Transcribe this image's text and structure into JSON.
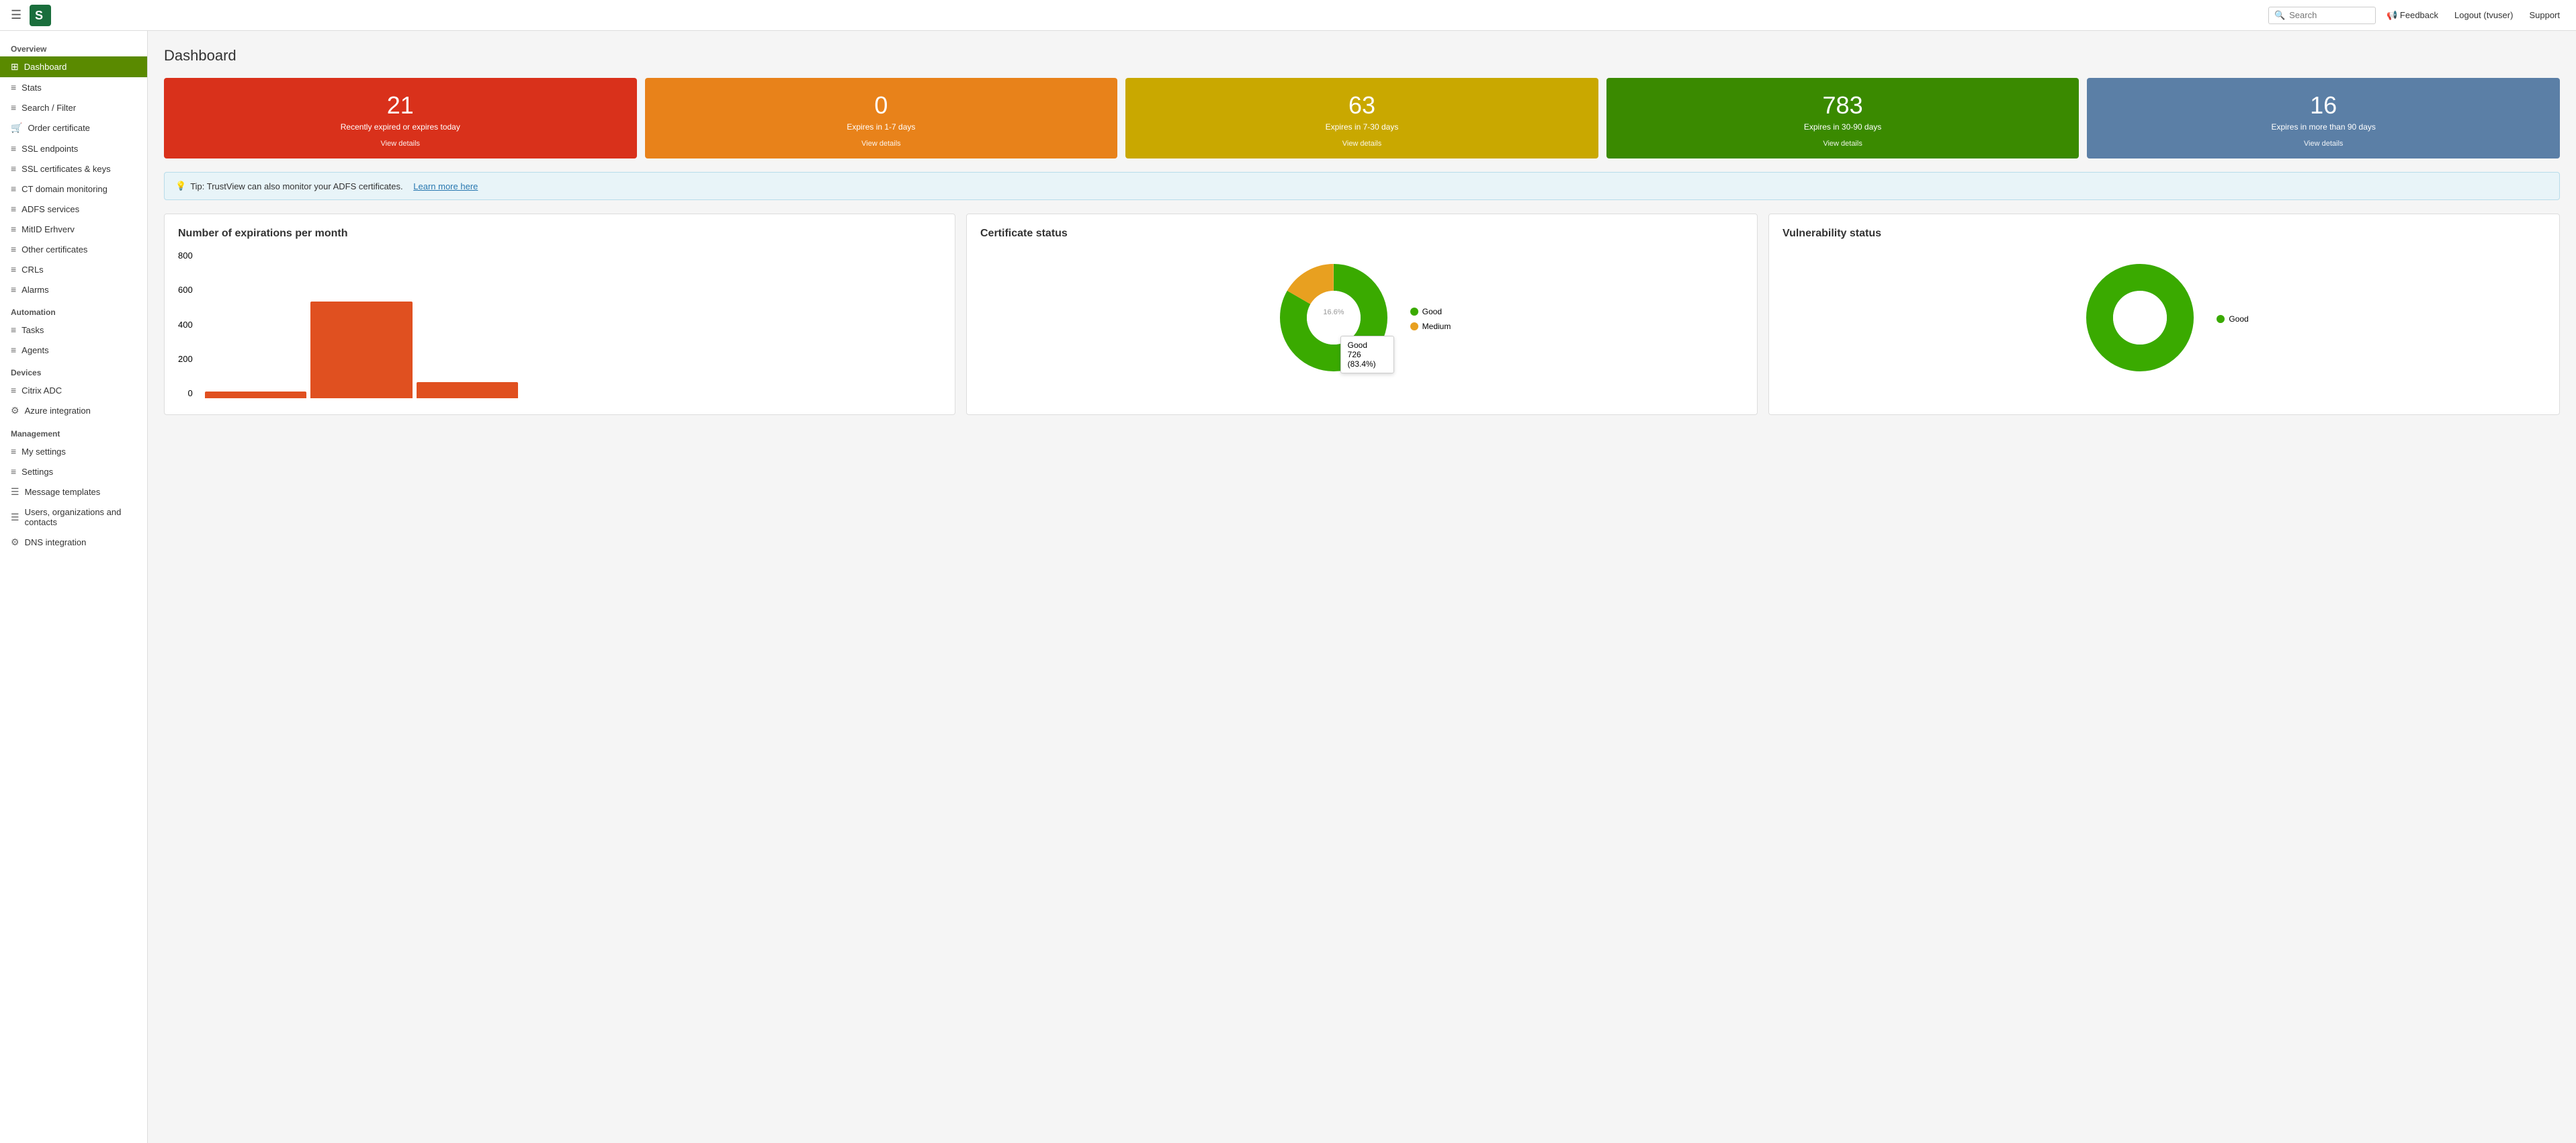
{
  "topbar": {
    "search_placeholder": "Search",
    "feedback_label": "Feedback",
    "logout_label": "Logout (tvuser)",
    "support_label": "Support"
  },
  "sidebar": {
    "overview_section": "Overview",
    "automation_section": "Automation",
    "devices_section": "Devices",
    "management_section": "Management",
    "items": [
      {
        "id": "dashboard",
        "label": "Dashboard",
        "active": true
      },
      {
        "id": "stats",
        "label": "Stats",
        "active": false
      },
      {
        "id": "search-filter",
        "label": "Search / Filter",
        "active": false
      },
      {
        "id": "order-certificate",
        "label": "Order certificate",
        "active": false
      },
      {
        "id": "ssl-endpoints",
        "label": "SSL endpoints",
        "active": false
      },
      {
        "id": "ssl-certificates",
        "label": "SSL certificates & keys",
        "active": false
      },
      {
        "id": "ct-domain",
        "label": "CT domain monitoring",
        "active": false
      },
      {
        "id": "adfs",
        "label": "ADFS services",
        "active": false
      },
      {
        "id": "mitid",
        "label": "MitID Erhverv",
        "active": false
      },
      {
        "id": "other-certs",
        "label": "Other certificates",
        "active": false
      },
      {
        "id": "crls",
        "label": "CRLs",
        "active": false
      },
      {
        "id": "alarms",
        "label": "Alarms",
        "active": false
      },
      {
        "id": "tasks",
        "label": "Tasks",
        "active": false
      },
      {
        "id": "agents",
        "label": "Agents",
        "active": false
      },
      {
        "id": "citrix",
        "label": "Citrix ADC",
        "active": false
      },
      {
        "id": "azure",
        "label": "Azure integration",
        "active": false
      },
      {
        "id": "my-settings",
        "label": "My settings",
        "active": false
      },
      {
        "id": "settings",
        "label": "Settings",
        "active": false
      },
      {
        "id": "message-templates",
        "label": "Message templates",
        "active": false
      },
      {
        "id": "users-orgs",
        "label": "Users, organizations and contacts",
        "active": false
      },
      {
        "id": "dns-integration",
        "label": "DNS integration",
        "active": false
      }
    ]
  },
  "page": {
    "title": "Dashboard"
  },
  "stat_cards": [
    {
      "id": "expired",
      "number": "21",
      "desc": "Recently expired or expires today",
      "view": "View details",
      "color": "card-red"
    },
    {
      "id": "1-7",
      "number": "0",
      "desc": "Expires in 1-7 days",
      "view": "View details",
      "color": "card-orange"
    },
    {
      "id": "7-30",
      "number": "63",
      "desc": "Expires in 7-30 days",
      "view": "View details",
      "color": "card-yellow"
    },
    {
      "id": "30-90",
      "number": "783",
      "desc": "Expires in 30-90 days",
      "view": "View details",
      "color": "card-green"
    },
    {
      "id": "90plus",
      "number": "16",
      "desc": "Expires in more than 90 days",
      "view": "View details",
      "color": "card-blue"
    }
  ],
  "tip": {
    "text": "Tip: TrustView can also monitor your ADFS certificates.",
    "link_text": "Learn more here"
  },
  "charts": {
    "expirations": {
      "title": "Number of expirations per month",
      "y_labels": [
        "800",
        "600",
        "400",
        "200",
        "0"
      ],
      "bars": [
        {
          "label": "",
          "height_pct": 0.05
        },
        {
          "label": "",
          "height_pct": 0.72
        },
        {
          "label": "",
          "height_pct": 0.12
        },
        {
          "label": "",
          "height_pct": 0.0
        },
        {
          "label": "",
          "height_pct": 0.0
        },
        {
          "label": "",
          "height_pct": 0.0
        },
        {
          "label": "",
          "height_pct": 0.0
        }
      ]
    },
    "cert_status": {
      "title": "Certificate status",
      "legend": [
        {
          "label": "Good",
          "color": "#3aaa00"
        },
        {
          "label": "Medium",
          "color": "#e8a020"
        }
      ],
      "segments": [
        {
          "label": "Good",
          "value": 726,
          "pct": 83.4,
          "color": "#3aaa00"
        },
        {
          "label": "Medium",
          "value": 144,
          "pct": 16.6,
          "color": "#e8a020"
        }
      ],
      "tooltip": {
        "label": "Good",
        "value": "726 (83.4%)"
      }
    },
    "vuln_status": {
      "title": "Vulnerability status",
      "legend": [
        {
          "label": "Good",
          "color": "#3aaa00"
        }
      ],
      "segments": [
        {
          "label": "Good",
          "value": 100,
          "pct": 100,
          "color": "#3aaa00"
        }
      ]
    }
  }
}
